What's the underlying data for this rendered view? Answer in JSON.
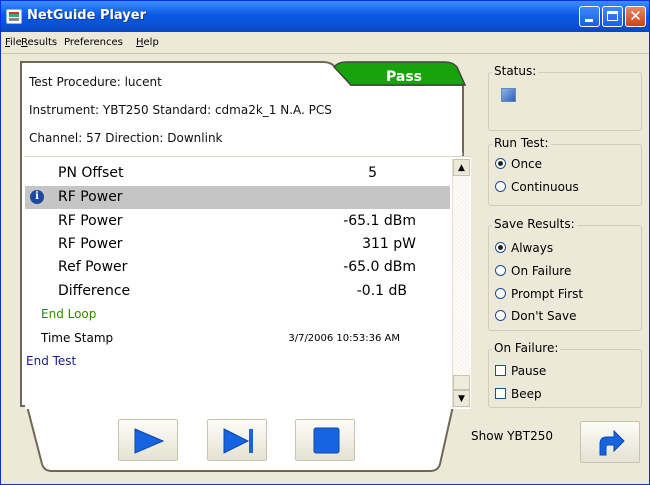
{
  "window": {
    "title": "NetGuide Player"
  },
  "menu": [
    {
      "label": "File",
      "underline": "F",
      "rest": "ile"
    },
    {
      "label": "Results",
      "underline": "R",
      "rest": "esults"
    },
    {
      "label": "Preferences",
      "underline": "",
      "rest": "Preferences"
    },
    {
      "label": "Help",
      "underline": "H",
      "rest": "elp"
    }
  ],
  "test_info": {
    "procedure": "Test Procedure: lucent",
    "instrument": "Instrument: YBT250 Standard: cdma2k_1 N.A. PCS",
    "channel": "Channel: 57 Direction: Downlink",
    "result_badge": "Pass"
  },
  "results": [
    {
      "name": "PN Offset",
      "value": "5"
    },
    {
      "name": "RF Power",
      "value": "",
      "selected": true,
      "icon": "info-icon"
    },
    {
      "name": "RF Power",
      "value": "-65.1 dBm"
    },
    {
      "name": "RF Power",
      "value": "311 pW"
    },
    {
      "name": "Ref Power",
      "value": "-65.0 dBm"
    },
    {
      "name": "Difference",
      "value": "-0.1 dB"
    },
    {
      "name": "End Loop",
      "value": ""
    },
    {
      "name": "Time Stamp",
      "value": "3/7/2006 10:53:36 AM"
    },
    {
      "name": "End Test",
      "value": ""
    }
  ],
  "status": {
    "title": "Status:"
  },
  "run_test": {
    "title": "Run Test:",
    "options": [
      "Once",
      "Continuous"
    ],
    "selected": "Once"
  },
  "save_results": {
    "title": "Save Results:",
    "options": [
      "Always",
      "On Failure",
      "Prompt First",
      "Don't Save"
    ],
    "selected": "Always"
  },
  "on_failure": {
    "title": "On Failure:",
    "options": [
      "Pause",
      "Beep"
    ],
    "checked": []
  },
  "footer": {
    "show_label": "Show YBT250"
  },
  "colors": {
    "accent": "#1664e1",
    "pass": "#1aa00f",
    "titlebar": "#0a5ae5"
  }
}
